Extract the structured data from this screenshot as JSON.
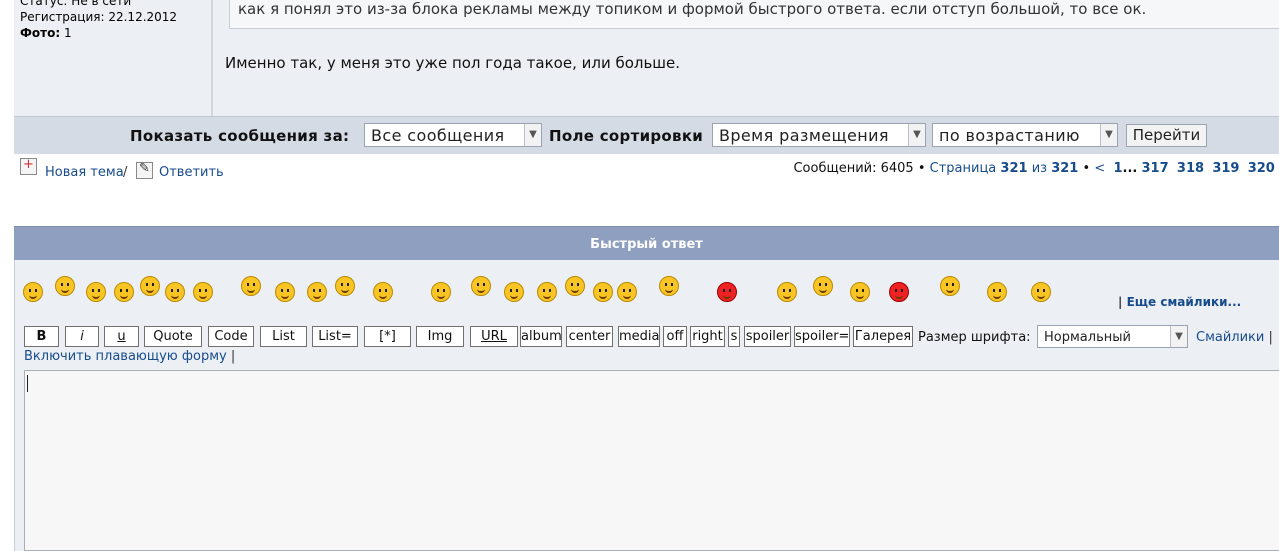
{
  "profile": {
    "status_label": "Статус:",
    "status_value": "Не в сети",
    "reg_label": "Регистрация:",
    "reg_value": "22.12.2012",
    "photo_label": "Фото:",
    "photo_value": "1"
  },
  "post": {
    "quote_text": "как я понял это из-за блока рекламы между топиком и формой быстрого ответа. если отступ большой, то все ок.",
    "body_text": "Именно так, у меня это уже пол года такое, или больше."
  },
  "sortbar": {
    "show_label": "Показать сообщения за:",
    "show_value": "Все сообщения",
    "sort_label": "Поле сортировки",
    "sort_value": "Время размещения",
    "order_value": "по возрастанию",
    "go_button": "Перейти"
  },
  "actions": {
    "new_topic": "Новая тема",
    "reply": "Ответить",
    "slash": "/"
  },
  "pager": {
    "count_text": "Сообщений: 6405 •",
    "page_word": "Страница",
    "current": "321",
    "of_word": "из",
    "total": "321",
    "bullet": "•",
    "prev": "<",
    "first": "1",
    "ellipsis": "...",
    "pages": [
      "317",
      "318",
      "319",
      "320"
    ]
  },
  "quick_reply": {
    "title": "Быстрый ответ",
    "more_smileys": "Еще смайлики...",
    "more_sep": "|",
    "buttons": [
      "B",
      "i",
      "u",
      "Quote",
      "Code",
      "List",
      "List=",
      "[*]",
      "Img",
      "URL",
      "album",
      "center",
      "media",
      "off",
      "right",
      "s",
      "spoiler",
      "spoiler=",
      "Галерея"
    ],
    "font_size_label": "Размер шрифта:",
    "font_size_value": "Нормальный",
    "smileys_link": "Смайлики",
    "floating_link": "Включить плавающую форму",
    "pipe": "|"
  },
  "smiley_icons": [
    "grin-smiley-icon",
    "smile-smiley-icon",
    "frown-smiley-icon",
    "yellow-circle-icon",
    "sad-smiley-icon",
    "tongue-smiley-icon",
    "glasses-smiley-icon",
    "blush-smiley-icon",
    "wink-smiley-icon",
    "neutral-smiley-icon",
    "confused-smiley-icon",
    "smoke-smiley-icon",
    "down-smiley-icon",
    "hug-smiley-icon",
    "shy-smiley-icon",
    "eek-smiley-icon",
    "cool-smiley-icon",
    "dance-smiley-icon",
    "party-smiley-icon",
    "laugh-smiley-icon",
    "angry-smiley-icon",
    "evil-smiley-icon",
    "hypno-smiley-icon",
    "think-smiley-icon",
    "devil-smiley-icon",
    "wave-smiley-icon",
    "thumbs-smiley-icon",
    "rofl-smiley-icon"
  ],
  "colors": {
    "header_bg": "#8e9fc0",
    "link": "#174c8c",
    "panel": "#eceff3",
    "sortbar": "#d5dbe4"
  }
}
